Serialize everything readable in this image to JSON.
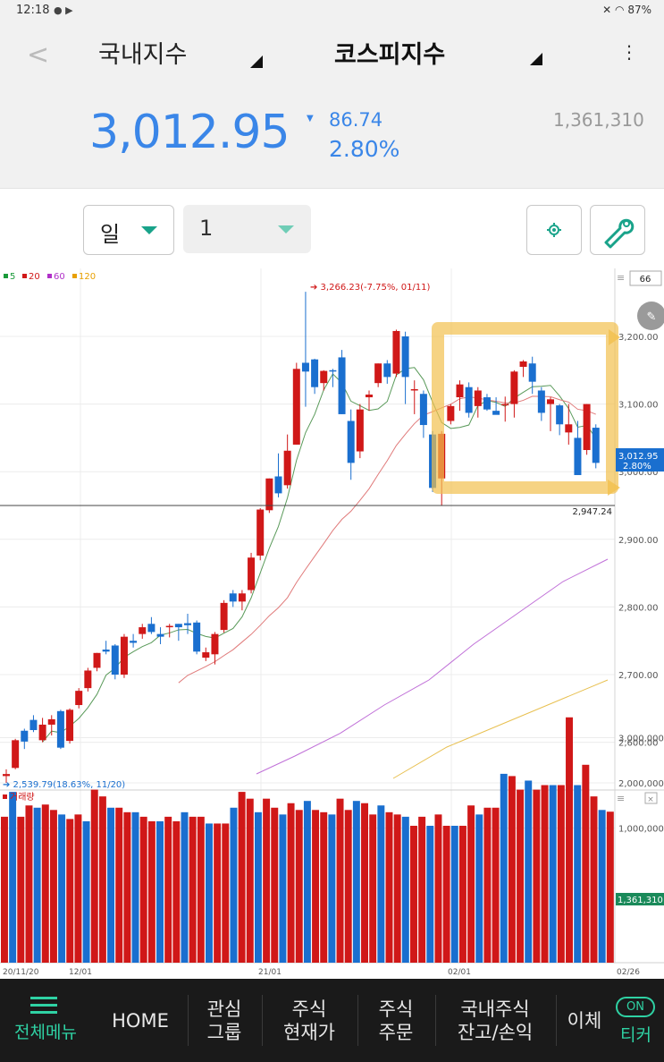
{
  "status_bar": {
    "time": "12:18",
    "battery": "87%"
  },
  "header": {
    "market_selector": "국내지수",
    "index_selector": "코스피지수",
    "price": "3,012.95",
    "change": "86.74",
    "change_percent": "2.80%",
    "volume": "1,361,310"
  },
  "toolbar": {
    "period_select": "일",
    "interval_select": "1"
  },
  "chart_top": {
    "legend": [
      {
        "label": "5",
        "color": "#1a9a3a"
      },
      {
        "label": "20",
        "color": "#d01818"
      },
      {
        "label": "60",
        "color": "#b030c8"
      },
      {
        "label": "120",
        "color": "#e8a000"
      }
    ],
    "zoom_value": "66",
    "max_annotation": "3,266.23(-7.75%, 01/11)",
    "min_annotation": "2,539.79(18.63%, 11/20)",
    "hline_label": "2,947.24",
    "current_price_tag": "3,012.95",
    "current_pct_tag": "2.80%",
    "yticks": [
      "3,200.00",
      "3,100.00",
      "3,000.00",
      "2,900.00",
      "2,800.00",
      "2,700.00",
      "2,600.00"
    ]
  },
  "chart_bottom": {
    "legend": "거래량",
    "yticks": [
      "3,000,000",
      "2,000,000",
      "1,000,000"
    ],
    "current_volume_tag": "1,361,310"
  },
  "xaxis_labels": [
    "20/11/20",
    "12/01",
    "21/01",
    "02/01",
    "02/26"
  ],
  "chart_data": {
    "type": "candlestick",
    "x": [
      "11/20",
      "11/23",
      "11/24",
      "11/25",
      "11/26",
      "11/27",
      "11/30",
      "12/01",
      "12/02",
      "12/03",
      "12/04",
      "12/07",
      "12/08",
      "12/09",
      "12/10",
      "12/11",
      "12/14",
      "12/15",
      "12/16",
      "12/17",
      "12/18",
      "12/21",
      "12/22",
      "12/23",
      "12/24",
      "12/28",
      "12/29",
      "12/30",
      "01/04",
      "01/05",
      "01/06",
      "01/07",
      "01/08",
      "01/11",
      "01/12",
      "01/13",
      "01/14",
      "01/15",
      "01/18",
      "01/19",
      "01/20",
      "01/21",
      "01/22",
      "01/25",
      "01/26",
      "01/27",
      "01/28",
      "01/29",
      "02/01",
      "02/02",
      "02/03",
      "02/04",
      "02/05",
      "02/08",
      "02/09",
      "02/10",
      "02/15",
      "02/16",
      "02/17",
      "02/18",
      "02/19",
      "02/22",
      "02/23",
      "02/24",
      "02/25",
      "02/26"
    ],
    "ohlc": [
      [
        2550,
        2560,
        2540,
        2553
      ],
      [
        2562,
        2605,
        2560,
        2603
      ],
      [
        2617,
        2620,
        2590,
        2601
      ],
      [
        2633,
        2640,
        2615,
        2618
      ],
      [
        2603,
        2636,
        2600,
        2626
      ],
      [
        2626,
        2640,
        2610,
        2634
      ],
      [
        2646,
        2648,
        2590,
        2592
      ],
      [
        2602,
        2650,
        2598,
        2648
      ],
      [
        2655,
        2680,
        2650,
        2676
      ],
      [
        2680,
        2710,
        2675,
        2706
      ],
      [
        2710,
        2732,
        2705,
        2732
      ],
      [
        2737,
        2750,
        2730,
        2734
      ],
      [
        2743,
        2745,
        2693,
        2700
      ],
      [
        2700,
        2760,
        2695,
        2756
      ],
      [
        2750,
        2760,
        2740,
        2747
      ],
      [
        2760,
        2775,
        2753,
        2770
      ],
      [
        2775,
        2785,
        2760,
        2763
      ],
      [
        2760,
        2770,
        2745,
        2756
      ],
      [
        2770,
        2775,
        2755,
        2772
      ],
      [
        2775,
        2775,
        2750,
        2770
      ],
      [
        2776,
        2790,
        2760,
        2773
      ],
      [
        2777,
        2780,
        2730,
        2734
      ],
      [
        2725,
        2740,
        2720,
        2733
      ],
      [
        2730,
        2763,
        2715,
        2760
      ],
      [
        2766,
        2810,
        2762,
        2806
      ],
      [
        2820,
        2825,
        2800,
        2808
      ],
      [
        2808,
        2825,
        2795,
        2820
      ],
      [
        2825,
        2880,
        2820,
        2873
      ],
      [
        2876,
        2946,
        2869,
        2944
      ],
      [
        2943,
        2990,
        2939,
        2990
      ],
      [
        2993,
        3027,
        2962,
        2968
      ],
      [
        2980,
        3055,
        2975,
        3031
      ],
      [
        3040,
        3161,
        3040,
        3152
      ],
      [
        3161,
        3266,
        3096,
        3148
      ],
      [
        3166,
        3167,
        3115,
        3125
      ],
      [
        3131,
        3150,
        3120,
        3149
      ],
      [
        3150,
        3152,
        3125,
        3149
      ],
      [
        3169,
        3180,
        3085,
        3085
      ],
      [
        3075,
        3092,
        2988,
        3013
      ],
      [
        3030,
        3100,
        3020,
        3092
      ],
      [
        3110,
        3120,
        3090,
        3114
      ],
      [
        3131,
        3160,
        3125,
        3160
      ],
      [
        3160,
        3165,
        3130,
        3140
      ],
      [
        3145,
        3210,
        3140,
        3208
      ],
      [
        3200,
        3207,
        3100,
        3140
      ],
      [
        3122,
        3135,
        3085,
        3122
      ],
      [
        3115,
        3120,
        3050,
        3069
      ],
      [
        3055,
        3060,
        2970,
        2976
      ],
      [
        2990,
        3060,
        2950,
        3056
      ],
      [
        3075,
        3100,
        3070,
        3097
      ],
      [
        3110,
        3135,
        3090,
        3129
      ],
      [
        3125,
        3132,
        3080,
        3087
      ],
      [
        3097,
        3125,
        3080,
        3120
      ],
      [
        3110,
        3115,
        3090,
        3092
      ],
      [
        3090,
        3110,
        3085,
        3084
      ],
      [
        3100,
        3111,
        3074,
        3100
      ],
      [
        3100,
        3150,
        3080,
        3148
      ],
      [
        3155,
        3165,
        3140,
        3163
      ],
      [
        3160,
        3170,
        3115,
        3133
      ],
      [
        3120,
        3125,
        3075,
        3087
      ],
      [
        3100,
        3110,
        3060,
        3107
      ],
      [
        3098,
        3100,
        3054,
        3070
      ],
      [
        3058,
        3100,
        3040,
        3070
      ],
      [
        3050,
        3075,
        2995,
        2995
      ],
      [
        3032,
        3100,
        3025,
        3100
      ],
      [
        3065,
        3070,
        3005,
        3013
      ]
    ],
    "volume": [
      1250000,
      1800000,
      1250000,
      1500000,
      1450000,
      1520000,
      1400000,
      1300000,
      1200000,
      1300000,
      1150000,
      1850000,
      1700000,
      1450000,
      1450000,
      1350000,
      1350000,
      1250000,
      1150000,
      1150000,
      1250000,
      1150000,
      1350000,
      1250000,
      1250000,
      1100000,
      1100000,
      1100000,
      1450000,
      1800000,
      1650000,
      1350000,
      1650000,
      1450000,
      1300000,
      1550000,
      1400000,
      1600000,
      1400000,
      1350000,
      1300000,
      1650000,
      1400000,
      1600000,
      1550000,
      1300000,
      1500000,
      1350000,
      1300000,
      1250000,
      1050000,
      1250000,
      1050000,
      1300000,
      1050000,
      1050000,
      1050000,
      1500000,
      1300000,
      1450000,
      1450000,
      2200000,
      2150000,
      1850000,
      2050000,
      1850000,
      1950000,
      1950000,
      1950000,
      3450000,
      1950000,
      2400000,
      1700000,
      1400000,
      1362000
    ],
    "ylim": [
      2530,
      3300
    ],
    "volume_ylim": [
      0,
      3500000
    ]
  }
}
